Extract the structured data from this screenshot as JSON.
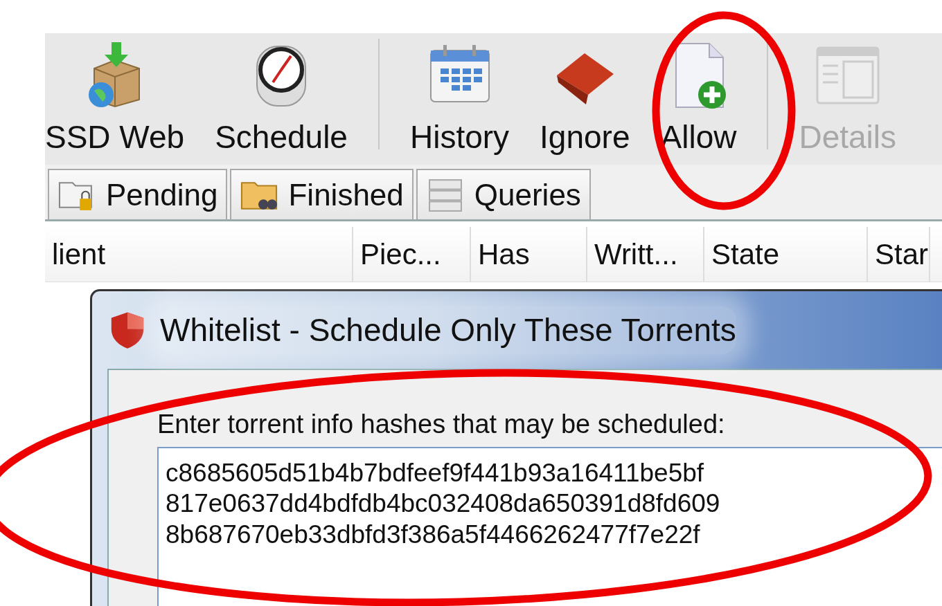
{
  "toolbar": {
    "items": [
      {
        "kind": "button",
        "label": "SSD Web",
        "disabled": false
      },
      {
        "kind": "button",
        "label": "Schedule",
        "disabled": false
      },
      {
        "kind": "separator"
      },
      {
        "kind": "button",
        "label": "History",
        "disabled": false
      },
      {
        "kind": "button",
        "label": "Ignore",
        "disabled": false
      },
      {
        "kind": "button",
        "label": "Allow",
        "disabled": false
      },
      {
        "kind": "separator"
      },
      {
        "kind": "button",
        "label": "Details",
        "disabled": true
      }
    ]
  },
  "tabs": [
    {
      "label": "Pending",
      "selected": false
    },
    {
      "label": "Finished",
      "selected": false
    },
    {
      "label": "Queries",
      "selected": false
    }
  ],
  "table": {
    "columns": [
      "lient",
      "Piec...",
      "Has",
      "Writt...",
      "State",
      "Star"
    ]
  },
  "dialog": {
    "title": "Whitelist - Schedule Only These Torrents",
    "label": "Enter torrent info hashes that may be scheduled:",
    "hashes": {
      "value": "c8685605d51b4b7bdfeef9f441b93a16411be5bf\n817e0637dd4bdfdb4bc032408da650391d8fd609\n8b687670eb33dbfd3f386a5f4466262477f7e22f"
    }
  },
  "annotations": [
    {
      "kind": "ellipse"
    },
    {
      "kind": "ellipse"
    }
  ]
}
